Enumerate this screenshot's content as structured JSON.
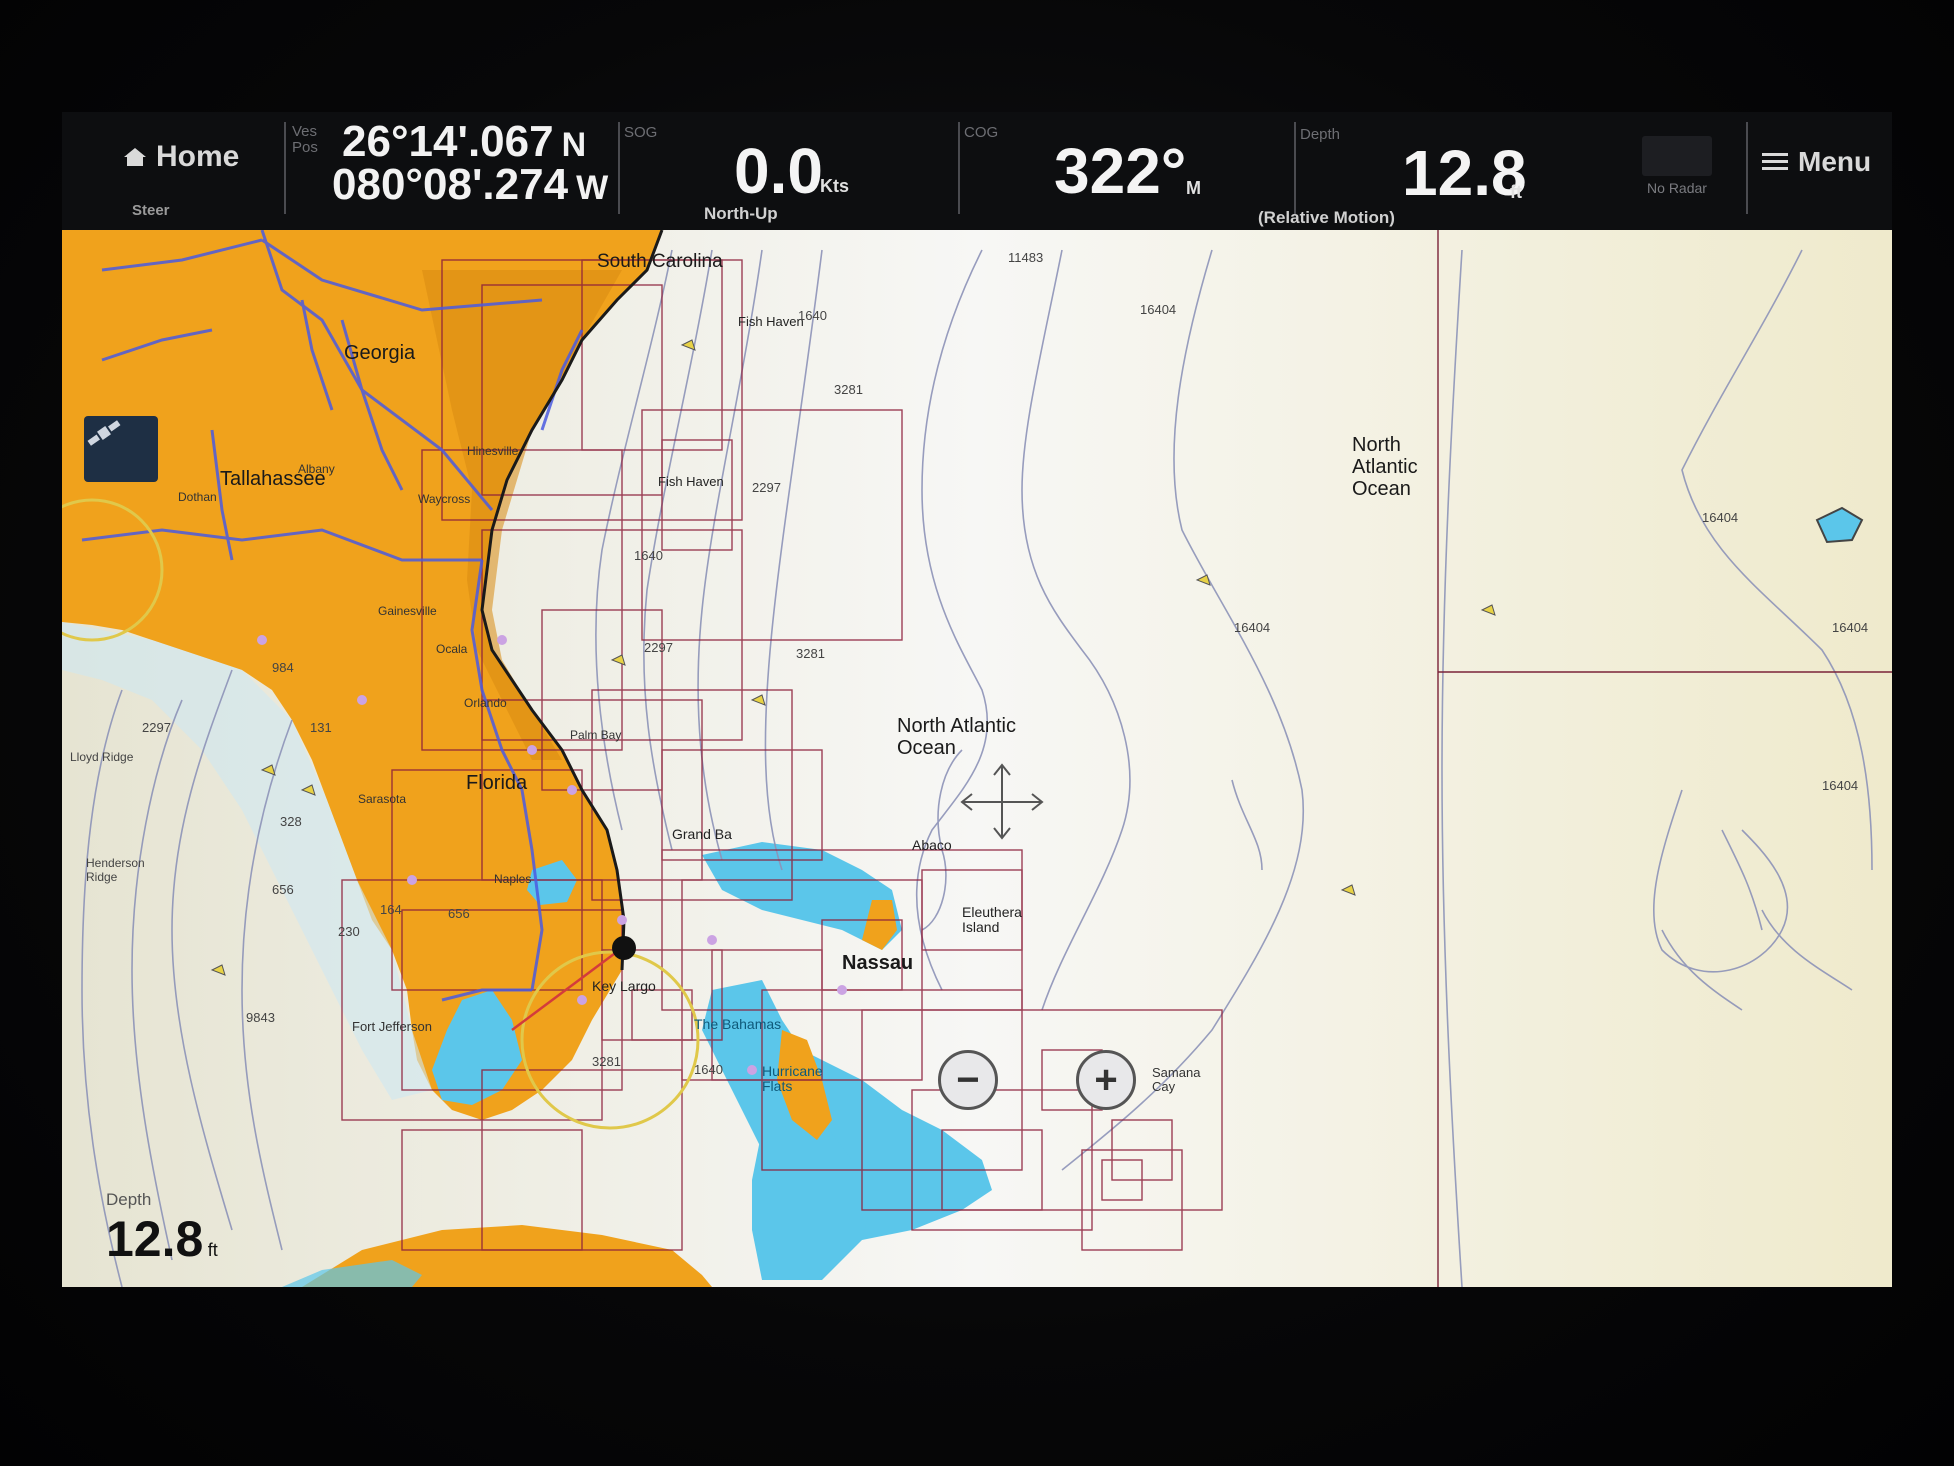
{
  "databar": {
    "home_label": "Home",
    "steer_label": "Steer",
    "pos_label": "Ves Pos",
    "latitude": "26°14'.067",
    "lat_hemi": "N",
    "longitude": "080°08'.274",
    "lon_hemi": "W",
    "sog_label": "SOG",
    "sog_value": "0.0",
    "sog_unit": "Kts",
    "orientation": "North-Up",
    "cog_label": "COG",
    "cog_value": "322°",
    "cog_unit": "M",
    "motion_mode": "(Relative Motion)",
    "depth_label": "Depth",
    "depth_value": "12.8",
    "depth_unit": "ft",
    "radar_status": "No Radar",
    "menu_label": "Menu"
  },
  "map": {
    "place_labels": {
      "south_carolina": "South Carolina",
      "georgia": "Georgia",
      "tallahassee": "Tallahassee",
      "florida": "Florida",
      "north_atlantic_ocean_1": "North Atlantic Ocean",
      "north_atlantic_ocean_2": "North Atlantic Ocean",
      "nassau": "Nassau",
      "abaco": "Abaco",
      "eleuthera": "Eleuthera Island",
      "grand_bahama": "Grand Ba",
      "key_largo": "Key Largo",
      "the_bahamas": "The Bahamas",
      "hurricane_flats": "Hurricane Flats",
      "fort_jefferson": "Fort Jefferson",
      "henderson_ridge": "Henderson Ridge",
      "lloyd_ridge": "Lloyd Ridge",
      "samana_cay": "Samana Cay",
      "fish_haven_1": "Fish Haven",
      "fish_haven_2": "Fish Haven",
      "hinesville": "Hinesville",
      "waycross": "Waycross",
      "dothan": "Dothan",
      "albany": "Albany",
      "gainesville": "Gainesville",
      "ocala": "Ocala",
      "orlando": "Orlando",
      "palm_bay": "Palm Bay",
      "naples": "Naples",
      "sarasota": "Sarasota"
    },
    "soundings": {
      "s11483": "11483",
      "s16404a": "16404",
      "s16404b": "16404",
      "s16404c": "16404",
      "s16404d": "16404",
      "s16404e": "16404",
      "s3281a": "3281",
      "s3281b": "3281",
      "s3281c": "3281",
      "s2297a": "2297",
      "s2297b": "2297",
      "s2297c": "2297",
      "s1640a": "1640",
      "s1640b": "1640",
      "s1640c": "1640",
      "s984": "984",
      "s328": "328",
      "s656a": "656",
      "s656b": "656",
      "s164": "164",
      "s230": "230",
      "s9843": "9843",
      "s131": "131"
    },
    "bottom_depth": {
      "label": "Depth",
      "value": "12.8",
      "unit": "ft"
    },
    "zoom_out_symbol": "−",
    "zoom_in_symbol": "+"
  },
  "colors": {
    "land": "#f0a21c",
    "land_dark": "#d98a12",
    "shallow": "#5bc6ea",
    "sea": "#f3f4f4",
    "chart_frame": "#8d1f3b",
    "road": "#4b5be0",
    "contour": "#8d93b8"
  }
}
